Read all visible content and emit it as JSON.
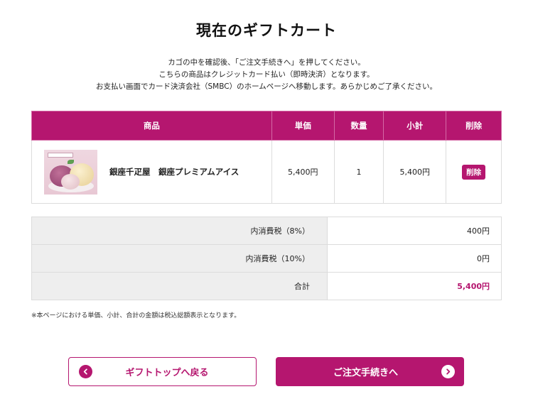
{
  "page": {
    "title": "現在のギフトカート",
    "intro": [
      "カゴの中を確認後、「ご注文手続きへ」を押してください。",
      "こちらの商品はクレジットカード払い（即時決済）となります。",
      "お支払い画面でカード決済会社（SMBC）のホームページへ移動します。あらかじめご了承ください。"
    ]
  },
  "cart": {
    "headers": {
      "product": "商品",
      "unit_price": "単価",
      "quantity": "数量",
      "subtotal": "小計",
      "delete": "削除"
    },
    "items": [
      {
        "name": "銀座千疋屋　銀座プレミアムアイス",
        "unit_price": "5,400円",
        "quantity": "1",
        "subtotal": "5,400円",
        "delete_label": "削除"
      }
    ]
  },
  "summary": {
    "rows": [
      {
        "label": "内消費税（8%）",
        "value": "400円"
      },
      {
        "label": "内消費税（10%）",
        "value": "0円"
      },
      {
        "label": "合計",
        "value": "5,400円"
      }
    ]
  },
  "note": "※本ページにおける単価、小計、合計の金額は税込総額表示となります。",
  "buttons": {
    "back": "ギフトトップへ戻る",
    "next": "ご注文手続きへ"
  },
  "colors": {
    "accent": "#b5166f",
    "header_text": "#ffffff",
    "summary_label_bg": "#eeeeee"
  }
}
